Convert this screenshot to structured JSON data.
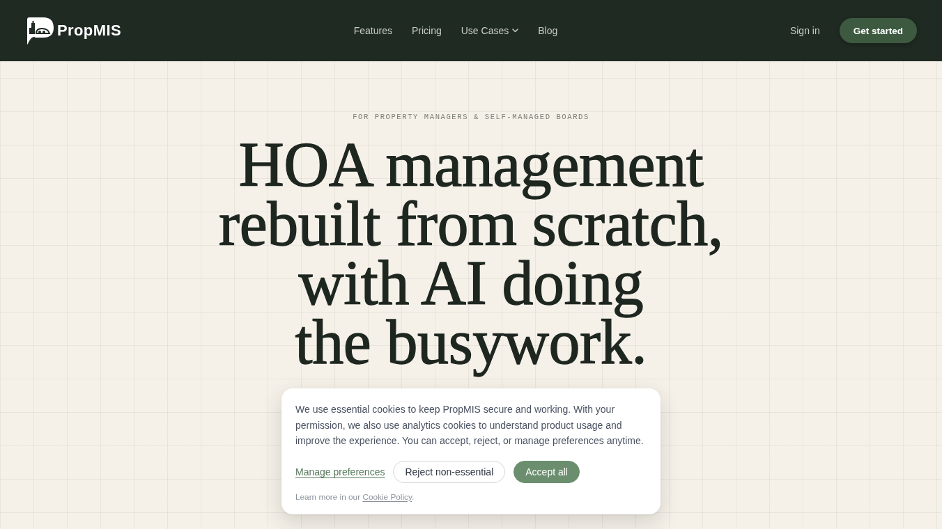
{
  "header": {
    "brand": "PropMIS",
    "nav_links": [
      {
        "label": "Features",
        "dropdown": false
      },
      {
        "label": "Pricing",
        "dropdown": false
      },
      {
        "label": "Use Cases",
        "dropdown": true
      },
      {
        "label": "Blog",
        "dropdown": false
      }
    ],
    "sign_in": "Sign in",
    "cta": "Get started"
  },
  "hero": {
    "eyebrow": "FOR PROPERTY MANAGERS & SELF-MANAGED BOARDS",
    "headline": "HOA management\nrebuilt from scratch,\nwith AI doing\nthe busywork."
  },
  "cookie_banner": {
    "message": "We use essential cookies to keep PropMIS secure and working. With your permission, we also use analytics cookies to understand product usage and improve the experience. You can accept, reject, or manage preferences anytime.",
    "actions": [
      {
        "kind": "link",
        "label": "Manage preferences"
      },
      {
        "kind": "outline",
        "label": "Reject non-essential"
      },
      {
        "kind": "primary",
        "label": "Accept all"
      }
    ],
    "footnote": {
      "prefix": "Learn more in our",
      "link": "Cookie Policy",
      "suffix": "."
    }
  }
}
